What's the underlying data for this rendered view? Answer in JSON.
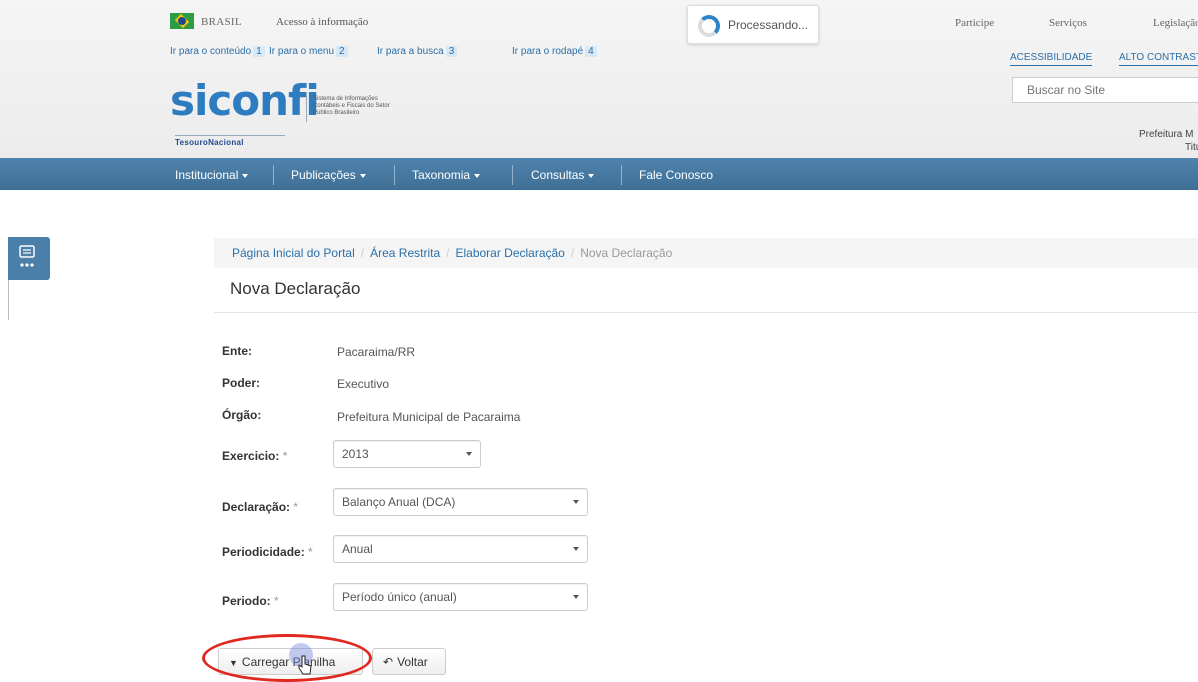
{
  "gov_bar": {
    "country": "BRASIL",
    "info_link": "Acesso à informação",
    "top_links": [
      "Participe",
      "Serviços",
      "Legislação"
    ],
    "processing_text": "Processando..."
  },
  "skip_links": [
    {
      "label": "Ir para o conteúdo",
      "key": "1"
    },
    {
      "label": "Ir para o menu",
      "key": "2"
    },
    {
      "label": "Ir para a busca",
      "key": "3"
    },
    {
      "label": "Ir para o rodapé",
      "key": "4"
    }
  ],
  "accessibility": {
    "accessibility_label": "ACESSIBILIDADE",
    "contrast_label": "ALTO CONTRASTE"
  },
  "brand": {
    "logo_text": "siconfi",
    "description": "Sistema de Informações Contábeis e Fiscais do Setor Público Brasileiro",
    "sub_brand": "TesouroNacional"
  },
  "search": {
    "placeholder": "Buscar no Site"
  },
  "user": {
    "org_line": "Prefeitura M",
    "role_line": "Titu"
  },
  "nav": [
    {
      "label": "Institucional"
    },
    {
      "label": "Publicações"
    },
    {
      "label": "Taxonomia"
    },
    {
      "label": "Consultas"
    },
    {
      "label": "Fale Conosco"
    }
  ],
  "breadcrumb": [
    "Página Inicial do Portal",
    "Área Restrita",
    "Elaborar Declaração",
    "Nova Declaração"
  ],
  "page": {
    "title": "Nova Declaração"
  },
  "info": [
    {
      "label": "Ente:",
      "value": "Pacaraima/RR"
    },
    {
      "label": "Poder:",
      "value": "Executivo"
    },
    {
      "label": "Órgão:",
      "value": "Prefeitura Municipal de Pacaraima"
    }
  ],
  "form": {
    "required_mark": "*",
    "exercicio": {
      "label": "Exercicio:",
      "value": "2013"
    },
    "declaracao": {
      "label": "Declaração:",
      "value": "Balanço Anual (DCA)"
    },
    "periodicidade": {
      "label": "Periodicidade:",
      "value": "Anual"
    },
    "periodo": {
      "label": "Periodo:",
      "value": "Período único (anual)"
    }
  },
  "actions": {
    "upload_label": "Carregar Planilha",
    "back_label": "Voltar"
  },
  "colors": {
    "navbar": "#4a7fa9",
    "link": "#2b6fa8",
    "highlight_ellipse": "#e0281f"
  }
}
